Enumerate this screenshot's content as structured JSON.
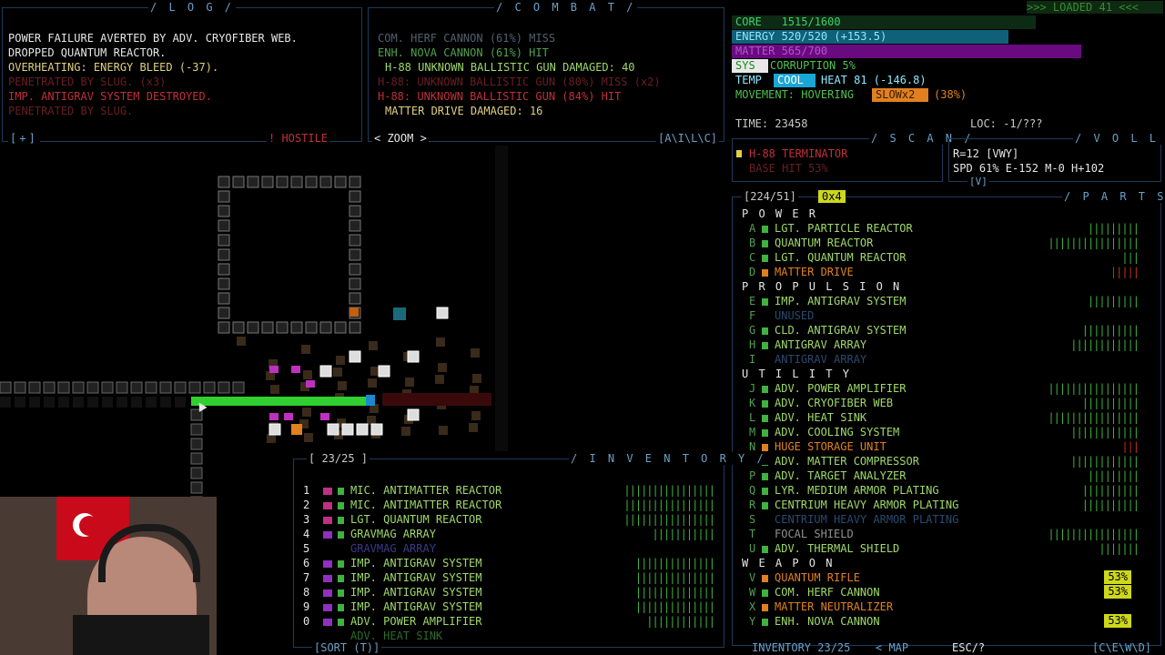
{
  "log": {
    "title": "/ L O G /",
    "lines": [
      "POWER FAILURE AVERTED BY ADV. CRYOFIBER WEB.",
      "DROPPED QUANTUM REACTOR.",
      "OVERHEATING: ENERGY BLEED (-37).",
      "PENETRATED BY SLUG. (x3)",
      "IMP. ANTIGRAV SYSTEM DESTROYED.",
      "PENETRATED BY SLUG."
    ],
    "footer_left": "[+]",
    "footer_right": "! HOSTILE"
  },
  "combat": {
    "title": "/ C O M B A T /",
    "lines": [
      "COM. HERF CANNON (61%) MISS",
      "ENH. NOVA CANNON (61%) HIT",
      "H-88 UNKNOWN BALLISTIC GUN DAMAGED: 40",
      "H-88: UNKNOWN BALLISTIC GUN (80%) MISS (x2)",
      "H-88: UNKNOWN BALLISTIC GUN (84%) HIT",
      "MATTER DRIVE DAMAGED: 16"
    ],
    "zoom": "< ZOOM >",
    "footer_right": "[A\\I\\L\\C]"
  },
  "status": {
    "loaded": ">>> LOADED 41 <<<",
    "core": "CORE   1515/1600",
    "energy": "ENERGY 520/520 (+153.5)",
    "matter": "MATTER 565/700",
    "corruption_tag": "SYS",
    "corruption": "CORRUPTION 5%",
    "temp_label": "TEMP",
    "temp_state": "COOL",
    "heat": "HEAT 81 (-146.8)",
    "movement": "MOVEMENT: HOVERING",
    "slow": "SLOWx2",
    "slow_pct": "(38%)",
    "time": "TIME: 23458",
    "loc": "LOC: -1/???"
  },
  "scan": {
    "title": "/ S C A N /",
    "target": "H-88 TERMINATOR",
    "base_hit": "BASE HIT 53%"
  },
  "volley": {
    "title": "/ V O L L E Y /",
    "line1": "R=12 [VWY]",
    "line2": "SPD 61% E-152 M-0 H+102",
    "footer": "[V]"
  },
  "parts": {
    "title": "/ P A R T S /",
    "capacity": "[224/51]",
    "tag": "0x4",
    "sections": [
      {
        "name": "P O W E R",
        "items": [
          {
            "key": "A",
            "name": "LGT. PARTICLE REACTOR",
            "color": "#3fb23f",
            "bar": "|||||||||"
          },
          {
            "key": "B",
            "name": "QUANTUM REACTOR",
            "color": "#3fb23f",
            "bar": "||||||||||||||||"
          },
          {
            "key": "C",
            "name": "LGT. QUANTUM REACTOR",
            "color": "#3fb23f",
            "bar": "|||"
          },
          {
            "key": "D",
            "name": "MATTER DRIVE",
            "color": "#e08020",
            "bar": "|||||"
          }
        ]
      },
      {
        "name": "P R O P U L S I O N",
        "items": [
          {
            "key": "E",
            "name": "IMP. ANTIGRAV SYSTEM",
            "color": "#3fb23f",
            "bar": "|||||||||"
          },
          {
            "key": "F",
            "name": "UNUSED",
            "color": "",
            "bar": ""
          },
          {
            "key": "G",
            "name": "CLD. ANTIGRAV SYSTEM",
            "color": "#3fb23f",
            "bar": "||||||||||"
          },
          {
            "key": "H",
            "name": "ANTIGRAV ARRAY",
            "color": "#3fb23f",
            "bar": "||||||||||||"
          },
          {
            "key": "I",
            "name": "ANTIGRAV ARRAY",
            "color": "",
            "bar": ""
          }
        ]
      },
      {
        "name": "U T I L I T Y",
        "items": [
          {
            "key": "J",
            "name": "ADV. POWER AMPLIFIER",
            "color": "#3fb23f",
            "bar": "||||||||||||||||"
          },
          {
            "key": "K",
            "name": "ADV. CRYOFIBER WEB",
            "color": "#3fb23f",
            "bar": "||||||||||"
          },
          {
            "key": "L",
            "name": "ADV. HEAT SINK",
            "color": "#3fb23f",
            "bar": "||||||||||||||||"
          },
          {
            "key": "M",
            "name": "ADV. COOLING SYSTEM",
            "color": "#3fb23f",
            "bar": "||||||||||||"
          },
          {
            "key": "N",
            "name": "HUGE STORAGE UNIT",
            "color": "#e08020",
            "bar": "|||"
          },
          {
            "key": "O",
            "name": "ADV. MATTER COMPRESSOR",
            "color": "#3fb23f",
            "bar": "||||||||||||"
          },
          {
            "key": "P",
            "name": "ADV. TARGET ANALYZER",
            "color": "#3fb23f",
            "bar": "|||||||||"
          },
          {
            "key": "Q",
            "name": "LYR. MEDIUM ARMOR PLATING",
            "color": "#3fb23f",
            "bar": "||||||||||"
          },
          {
            "key": "R",
            "name": "CENTRIUM HEAVY ARMOR PLATING",
            "color": "#3fb23f",
            "bar": "||||||||||"
          },
          {
            "key": "S",
            "name": "CENTRIUM HEAVY ARMOR PLATING",
            "color": "",
            "bar": ""
          },
          {
            "key": "T",
            "name": "FOCAL SHIELD",
            "color": "",
            "bar": "||||||||||||||||"
          },
          {
            "key": "U",
            "name": "ADV. THERMAL SHIELD",
            "color": "#3fb23f",
            "bar": "|||||||"
          }
        ]
      },
      {
        "name": "W E A P O N",
        "items": [
          {
            "key": "V",
            "name": "QUANTUM RIFLE",
            "color": "#e08020",
            "bar": "",
            "pct": "53%"
          },
          {
            "key": "W",
            "name": "COM. HERF CANNON",
            "color": "#3fb23f",
            "bar": "",
            "pct": "53%"
          },
          {
            "key": "X",
            "name": "MATTER NEUTRALIZER",
            "color": "#e08020",
            "bar": ""
          },
          {
            "key": "Y",
            "name": "ENH. NOVA CANNON",
            "color": "#3fb23f",
            "bar": "",
            "pct": "53%"
          }
        ]
      }
    ]
  },
  "inventory": {
    "title": "/ I N V E N T O R Y /",
    "capacity": "[ 23/25 ]",
    "items": [
      {
        "key": "1",
        "name": "MIC. ANTIMATTER REACTOR",
        "bar": "||||||||||||||||"
      },
      {
        "key": "2",
        "name": "MIC. ANTIMATTER REACTOR",
        "bar": "||||||||||||||||"
      },
      {
        "key": "3",
        "name": "LGT. QUANTUM REACTOR",
        "bar": "||||||||||||||||"
      },
      {
        "key": "4",
        "name": "GRAVMAG ARRAY",
        "bar": "|||||||||||"
      },
      {
        "key": "5",
        "name": "GRAVMAG ARRAY",
        "bar": ""
      },
      {
        "key": "6",
        "name": "IMP. ANTIGRAV SYSTEM",
        "bar": "||||||||||||||"
      },
      {
        "key": "7",
        "name": "IMP. ANTIGRAV SYSTEM",
        "bar": "||||||||||||||"
      },
      {
        "key": "8",
        "name": "IMP. ANTIGRAV SYSTEM",
        "bar": "||||||||||||||"
      },
      {
        "key": "9",
        "name": "IMP. ANTIGRAV SYSTEM",
        "bar": "||||||||||||||"
      },
      {
        "key": "0",
        "name": "ADV. POWER AMPLIFIER",
        "bar": "||||||||||||"
      },
      {
        "key": "",
        "name": "ADV. HEAT SINK",
        "bar": ""
      }
    ],
    "sort": "[SORT (T)]"
  },
  "bottom": {
    "inventory": "INVENTORY 23/25",
    "map": "< MAP",
    "esc": "ESC/?",
    "keys": "[C\\E\\W\\D]"
  }
}
